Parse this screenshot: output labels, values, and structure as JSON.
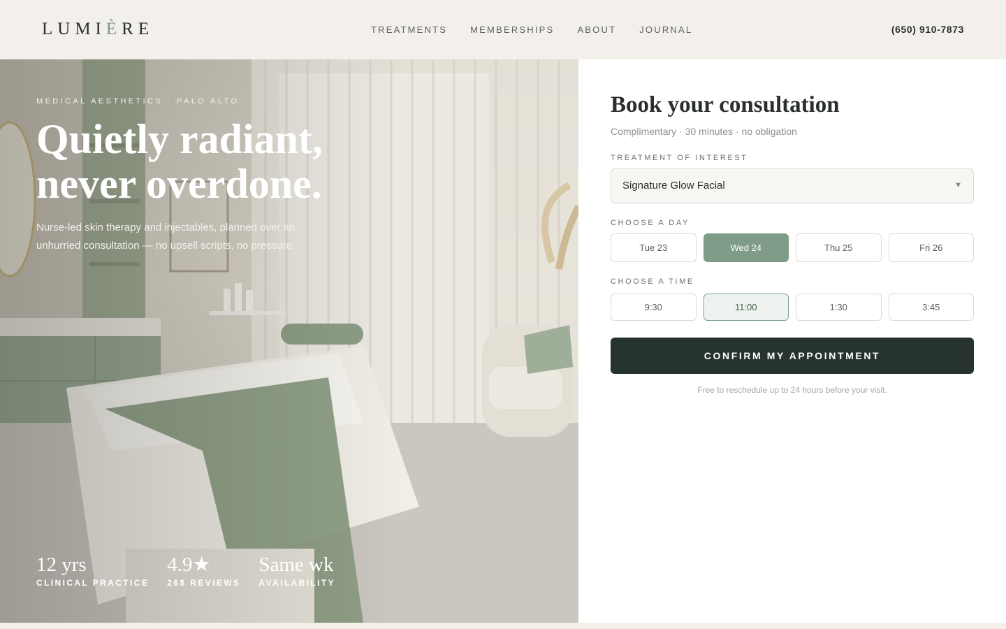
{
  "brand": {
    "logo_pre": "LUMI",
    "logo_accent": "È",
    "logo_post": "RE"
  },
  "nav": {
    "items": [
      "TREATMENTS",
      "MEMBERSHIPS",
      "ABOUT",
      "JOURNAL"
    ],
    "phone": "(650) 910-7873"
  },
  "hero": {
    "eyebrow": "MEDICAL AESTHETICS · PALO ALTO",
    "title_line1": "Quietly radiant,",
    "title_line2": "never overdone.",
    "subtitle": "Nurse-led skin therapy and injectables, planned over an unhurried consultation — no upsell scripts, no pressure.",
    "stats": [
      {
        "value": "12 yrs",
        "label": "CLINICAL PRACTICE"
      },
      {
        "value": "4.9★",
        "label": "268 REVIEWS"
      },
      {
        "value": "Same wk",
        "label": "AVAILABILITY"
      }
    ]
  },
  "booking": {
    "title": "Book your consultation",
    "subtitle": "Complimentary · 30 minutes · no obligation",
    "treatment_label": "TREATMENT OF INTEREST",
    "treatment_value": "Signature Glow Facial",
    "day_label": "CHOOSE A DAY",
    "days": [
      "Tue 23",
      "Wed 24",
      "Thu 25",
      "Fri 26"
    ],
    "selected_day": "Wed 24",
    "time_label": "CHOOSE A TIME",
    "times": [
      "9:30",
      "11:00",
      "1:30",
      "3:45"
    ],
    "selected_time": "11:00",
    "confirm_label": "CONFIRM MY APPOINTMENT",
    "note": "Free to reschedule up to 24 hours before your visit."
  },
  "colors": {
    "accent": "#7e9c87",
    "dark_button": "#263330",
    "background": "#f3f0ec"
  }
}
